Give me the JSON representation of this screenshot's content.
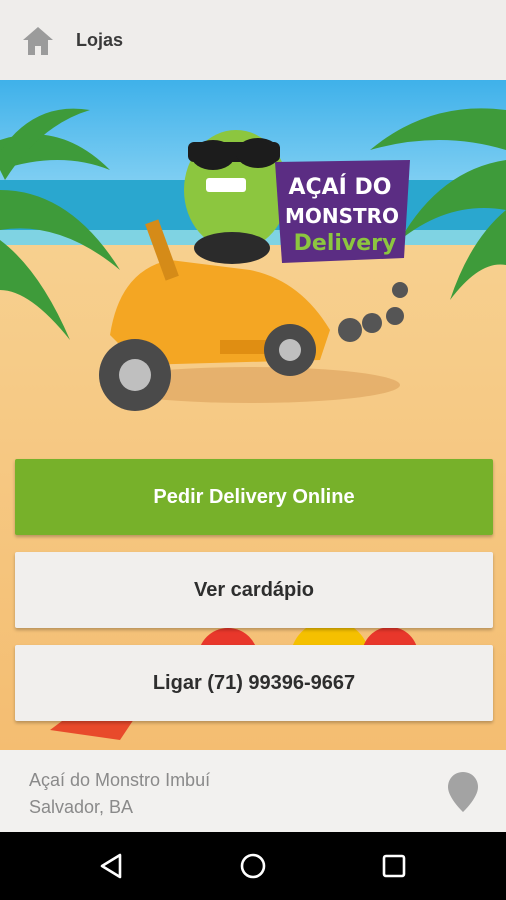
{
  "appbar": {
    "title": "Lojas",
    "home_icon": "home-icon"
  },
  "hero": {
    "logo_lines": [
      "AÇAÍ DO",
      "MONSTRO",
      "Delivery"
    ]
  },
  "buttons": {
    "delivery": "Pedir Delivery Online",
    "menu": "Ver cardápio",
    "call": "Ligar (71) 99396-9667"
  },
  "store": {
    "name": "Açaí do Monstro Imbuí",
    "city": "Salvador, BA",
    "icon": "map-pin-icon"
  },
  "navbar": {
    "back_icon": "back-icon",
    "home_icon": "home-circle-icon",
    "recents_icon": "recents-icon"
  },
  "colors": {
    "primary": "#77b12a",
    "sand": "#f6c67c",
    "sky": "#6ec6f0",
    "purple": "#5b2d83"
  }
}
